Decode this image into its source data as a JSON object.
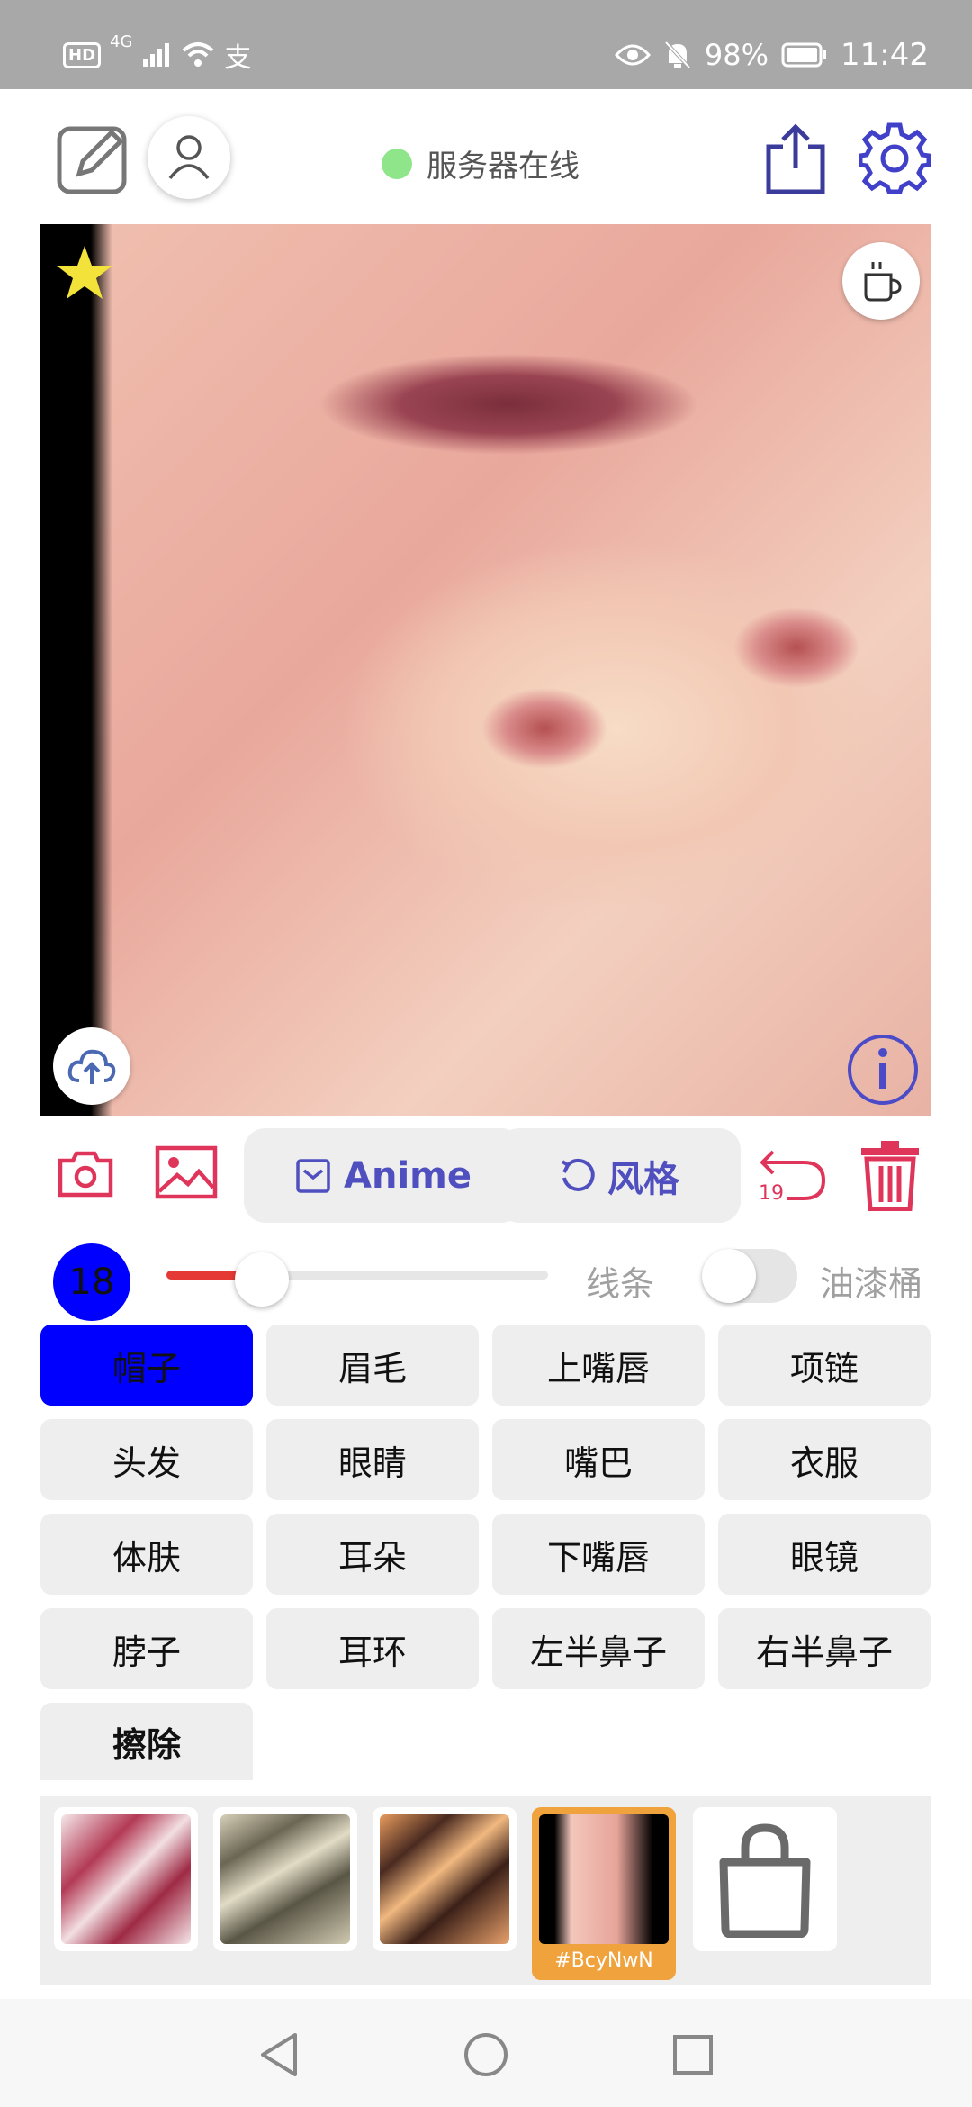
{
  "status_bar": {
    "left_icons": [
      "HD",
      "4G",
      "signal-icon",
      "wifi-icon",
      "alipay-icon"
    ],
    "network_label": "4G",
    "hd_label": "HD",
    "battery": "98%",
    "time": "11:42",
    "right_icons": [
      "eye-icon",
      "mute-bell-icon",
      "battery-icon"
    ]
  },
  "header": {
    "server_status": "服务器在线",
    "server_status_color": "#8fe58a",
    "icons": [
      "edit-square-icon",
      "user-icon",
      "share-icon",
      "settings-gear-icon"
    ]
  },
  "canvas": {
    "icons": [
      "star-icon",
      "coffee-cup-icon",
      "cloud-upload-icon",
      "info-icon"
    ],
    "star_color": "#f2e23a"
  },
  "toolbar": {
    "anime_label": "Anime",
    "style_label": "风格",
    "undo_count": "19",
    "icons": [
      "camera-icon",
      "image-icon",
      "checkbox-icon",
      "refresh-icon",
      "undo-icon",
      "trash-icon"
    ],
    "accent_red": "#e0355a",
    "accent_purple": "#4f4fbf"
  },
  "brush": {
    "size": "18",
    "slider_fraction": 0.25,
    "line_label": "线条",
    "bucket_label": "油漆桶",
    "bucket_enabled": false
  },
  "parts": {
    "row1": [
      "帽子",
      "眉毛",
      "上嘴唇",
      "项链"
    ],
    "row2": [
      "头发",
      "眼睛",
      "嘴巴",
      "衣服"
    ],
    "row3": [
      "体肤",
      "耳朵",
      "下嘴唇",
      "眼镜"
    ],
    "row4": [
      "脖子",
      "耳环",
      "左半鼻子",
      "右半鼻子"
    ],
    "erase": "擦除",
    "selected": "帽子",
    "selected_color": "#0000ff"
  },
  "styles": {
    "selected_tag": "#BcyNwN",
    "selected_border": "#f0a23c",
    "icons": [
      "shopping-bag-icon"
    ]
  },
  "nav": {
    "icons": [
      "back-triangle-icon",
      "home-circle-icon",
      "recents-square-icon"
    ]
  }
}
